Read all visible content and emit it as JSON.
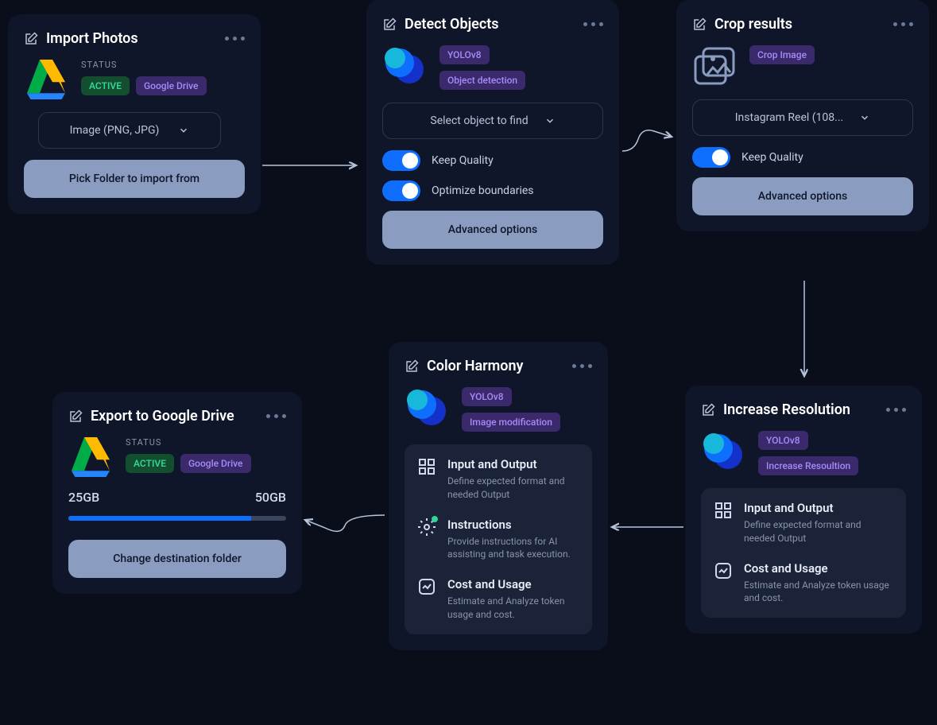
{
  "import": {
    "title": "Import Photos",
    "status_label": "STATUS",
    "active": "ACTIVE",
    "provider": "Google Drive",
    "select_label": "Image (PNG, JPG)",
    "button": "Pick Folder to import from"
  },
  "detect": {
    "title": "Detect Objects",
    "tag1": "YOLOv8",
    "tag2": "Object detection",
    "select_label": "Select object to find",
    "toggle1": "Keep Quality",
    "toggle2": "Optimize boundaries",
    "button": "Advanced options"
  },
  "crop": {
    "title": "Crop results",
    "tag1": "Crop Image",
    "select_label": "Instagram Reel (108...",
    "toggle1": "Keep Quality",
    "button": "Advanced options"
  },
  "resolution": {
    "title": "Increase Resolution",
    "tag1": "YOLOv8",
    "tag2": "Increase Resoultion",
    "panel1_title": "Input and Output",
    "panel1_sub": "Define expected format and needed Output",
    "panel2_title": "Cost and Usage",
    "panel2_sub": "Estimate and Analyze token usage and cost."
  },
  "color": {
    "title": "Color Harmony",
    "tag1": "YOLOv8",
    "tag2": "Image modification",
    "panel1_title": "Input and Output",
    "panel1_sub": "Define expected format and needed Output",
    "panel2_title": "Instructions",
    "panel2_sub": "Provide instructions for AI assisting and task execution.",
    "panel3_title": "Cost and Usage",
    "panel3_sub": "Estimate and Analyze token usage and cost."
  },
  "export": {
    "title": "Export to Google Drive",
    "status_label": "STATUS",
    "active": "ACTIVE",
    "provider": "Google Drive",
    "used": "25GB",
    "total": "50GB",
    "button": "Change destination folder"
  }
}
